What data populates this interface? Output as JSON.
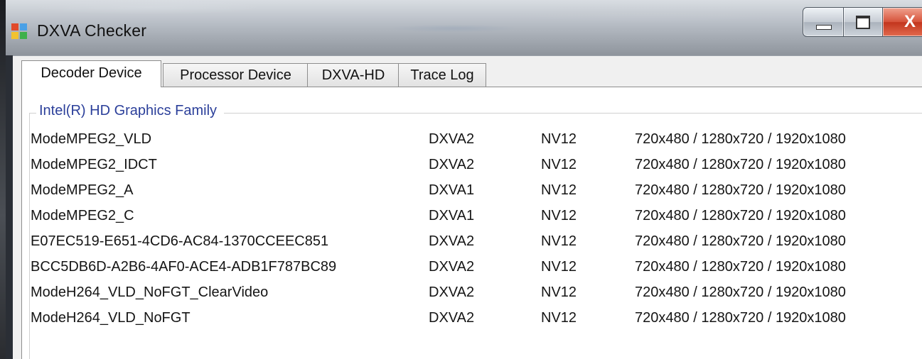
{
  "window": {
    "title": "DXVA Checker",
    "app_icon": "dxva-checker-app-icon",
    "controls": [
      {
        "name": "minimize",
        "icon": "minimize-icon"
      },
      {
        "name": "maximize",
        "icon": "maximize-icon"
      },
      {
        "name": "close",
        "icon": "close-icon",
        "label": "X"
      }
    ]
  },
  "tabs": [
    {
      "label": "Decoder Device",
      "active": true
    },
    {
      "label": "Processor Device",
      "active": false
    },
    {
      "label": "DXVA-HD",
      "active": false
    },
    {
      "label": "Trace Log",
      "active": false
    }
  ],
  "device_group": {
    "title": "Intel(R)  HD Graphics Family",
    "rows": [
      {
        "mode": "ModeMPEG2_VLD",
        "api": "DXVA2",
        "format": "NV12",
        "resolutions": "720x480 / 1280x720 / 1920x1080"
      },
      {
        "mode": "ModeMPEG2_IDCT",
        "api": "DXVA2",
        "format": "NV12",
        "resolutions": "720x480 / 1280x720 / 1920x1080"
      },
      {
        "mode": "ModeMPEG2_A",
        "api": "DXVA1",
        "format": "NV12",
        "resolutions": "720x480 / 1280x720 / 1920x1080"
      },
      {
        "mode": "ModeMPEG2_C",
        "api": "DXVA1",
        "format": "NV12",
        "resolutions": "720x480 / 1280x720 / 1920x1080"
      },
      {
        "mode": "E07EC519-E651-4CD6-AC84-1370CCEEC851",
        "api": "DXVA2",
        "format": "NV12",
        "resolutions": "720x480 / 1280x720 / 1920x1080"
      },
      {
        "mode": "BCC5DB6D-A2B6-4AF0-ACE4-ADB1F787BC89",
        "api": "DXVA2",
        "format": "NV12",
        "resolutions": "720x480 / 1280x720 / 1920x1080"
      },
      {
        "mode": "ModeH264_VLD_NoFGT_ClearVideo",
        "api": "DXVA2",
        "format": "NV12",
        "resolutions": "720x480 / 1280x720 / 1920x1080"
      },
      {
        "mode": "ModeH264_VLD_NoFGT",
        "api": "DXVA2",
        "format": "NV12",
        "resolutions": "720x480 / 1280x720 / 1920x1080"
      }
    ]
  },
  "colors": {
    "group_title": "#2b3f9a",
    "close_button": "#c2351d"
  }
}
